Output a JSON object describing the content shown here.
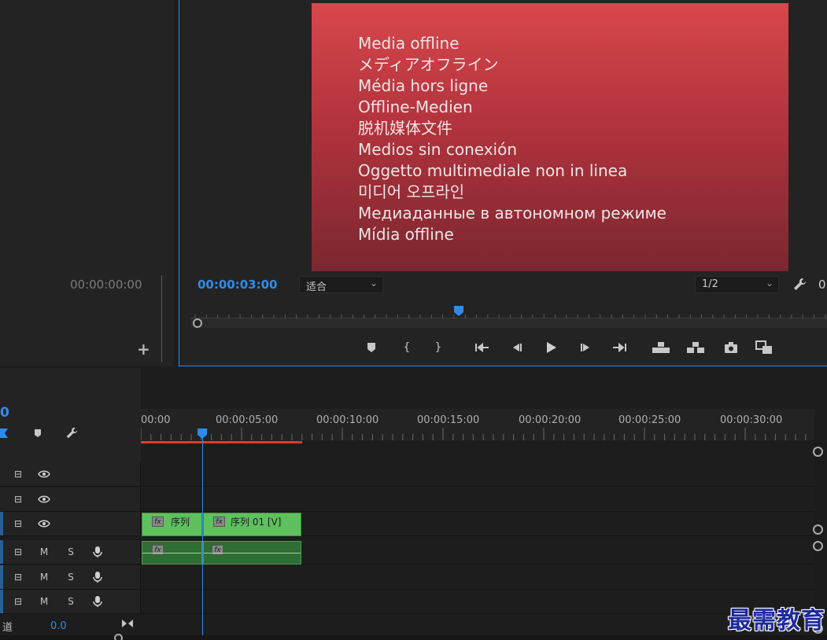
{
  "source_monitor": {
    "timecode": "00:00:00:00",
    "add_button": "+"
  },
  "program_monitor": {
    "offline_lines": [
      "Media offline",
      "メディアオフライン",
      "Média hors ligne",
      "Offline-Medien",
      "脱机媒体文件",
      "Medios sin conexión",
      "Oggetto multimediale non in linea",
      "미디어 오프라인",
      "Медиаданные в автономном режиме",
      "Mídia offline"
    ],
    "timecode": "00:00:03:00",
    "fit_dropdown": "适合",
    "resolution_dropdown": "1/2",
    "partial_char": "0"
  },
  "timeline": {
    "current_time_partial": "0",
    "ruler_labels": [
      "00:00",
      "00:00:05:00",
      "00:00:10:00",
      "00:00:15:00",
      "00:00:20:00",
      "00:00:25:00",
      "00:00:30:00"
    ],
    "video_tracks": 3,
    "audio_tracks": [
      {
        "m": "M",
        "s": "S"
      },
      {
        "m": "M",
        "s": "S"
      },
      {
        "m": "M",
        "s": "S"
      }
    ],
    "clips": {
      "v1_clip1_label": "序列",
      "v1_clip2_label": "序列 01 [V]",
      "fx": "fx"
    },
    "master": {
      "label": "道",
      "value": "0.0"
    }
  },
  "watermark": "最需教育",
  "colors": {
    "accent": "#2d8ceb",
    "video_clip": "#5ec15e",
    "audio_clip": "#2e6d33",
    "work_area": "#e03b2d"
  }
}
